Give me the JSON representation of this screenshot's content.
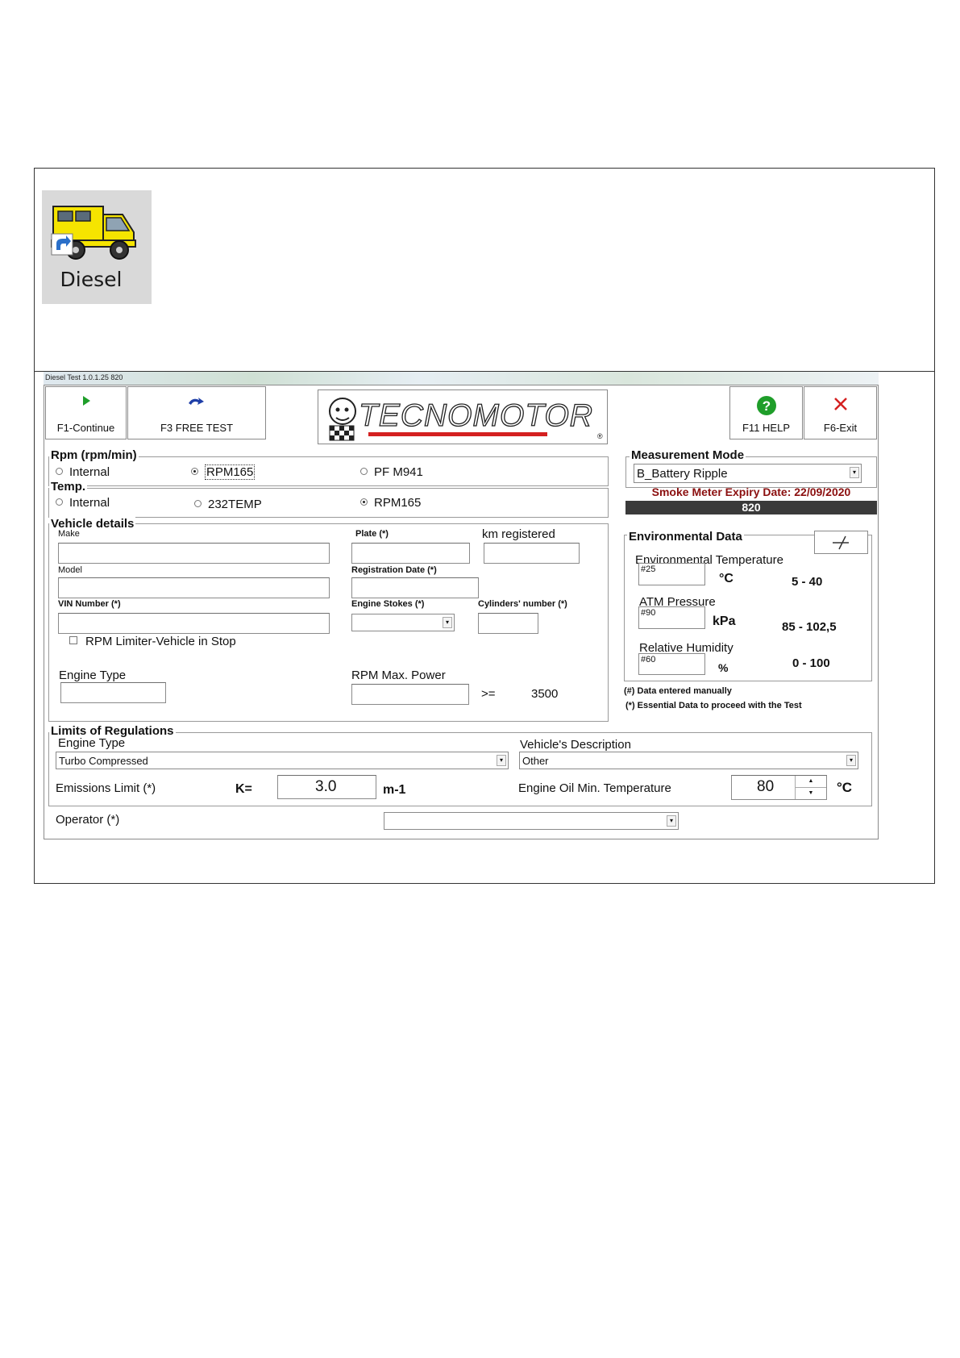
{
  "desktop_icon": {
    "label": "Diesel"
  },
  "window": {
    "title": "Diesel Test 1.0.1.25 820"
  },
  "toolbar": {
    "continue_label": "F1-Continue",
    "free_test_label": "F3 FREE TEST",
    "help_label": "F11 HELP",
    "exit_label": "F6-Exit"
  },
  "logo": {
    "text": "TECNOMOTOR",
    "mark": "®"
  },
  "rpm": {
    "title": "Rpm (rpm/min)",
    "options": [
      "Internal",
      "RPM165",
      "PF M941"
    ],
    "selected": "RPM165"
  },
  "temp": {
    "title": "Temp.",
    "options": [
      "Internal",
      "232TEMP",
      "RPM165"
    ],
    "selected": "RPM165"
  },
  "measurement": {
    "title": "Measurement Mode",
    "mode": "B_Battery Ripple",
    "expiry": "Smoke Meter Expiry Date: 22/09/2020",
    "serial": "820"
  },
  "vehicle": {
    "title": "Vehicle details",
    "make_label": "Make",
    "plate_label": "Plate (*)",
    "km_label": "km registered",
    "model_label": "Model",
    "regdate_label": "Registration Date (*)",
    "vin_label": "VIN Number (*)",
    "stokes_label": "Engine Stokes (*)",
    "cylinders_label": "Cylinders' number (*)",
    "limiter_label": "RPM Limiter-Vehicle in Stop",
    "engine_type_label": "Engine Type",
    "rpm_power_label": "RPM Max. Power",
    "rpm_cmp": ">=",
    "rpm_min": "3500"
  },
  "environment": {
    "title": "Environmental Data",
    "temp_label": "Environmental Temperature",
    "temp_value": "#25",
    "temp_unit": "°C",
    "temp_range": "5 - 40",
    "pressure_label": "ATM Pressure",
    "pressure_value": "#90",
    "pressure_unit": "kPa",
    "pressure_range": "85 - 102,5",
    "humidity_label": "Relative Humidity",
    "humidity_value": "#60",
    "humidity_unit": "%",
    "humidity_range": "0 - 100",
    "note_manual": "(#) Data entered manually",
    "note_essential": "(*) Essential Data to proceed with the Test"
  },
  "limits": {
    "title": "Limits of Regulations",
    "engine_type_label": "Engine Type",
    "engine_type_value": "Turbo Compressed",
    "vehicle_desc_label": "Vehicle's Description",
    "vehicle_desc_value": "Other",
    "emissions_label": "Emissions Limit (*)",
    "k_label": "K=",
    "k_value": "3.0",
    "k_unit": "m-1",
    "oil_label": "Engine Oil Min. Temperature",
    "oil_value": "80",
    "oil_unit": "°C"
  },
  "operator": {
    "label": "Operator (*)",
    "value": ""
  }
}
